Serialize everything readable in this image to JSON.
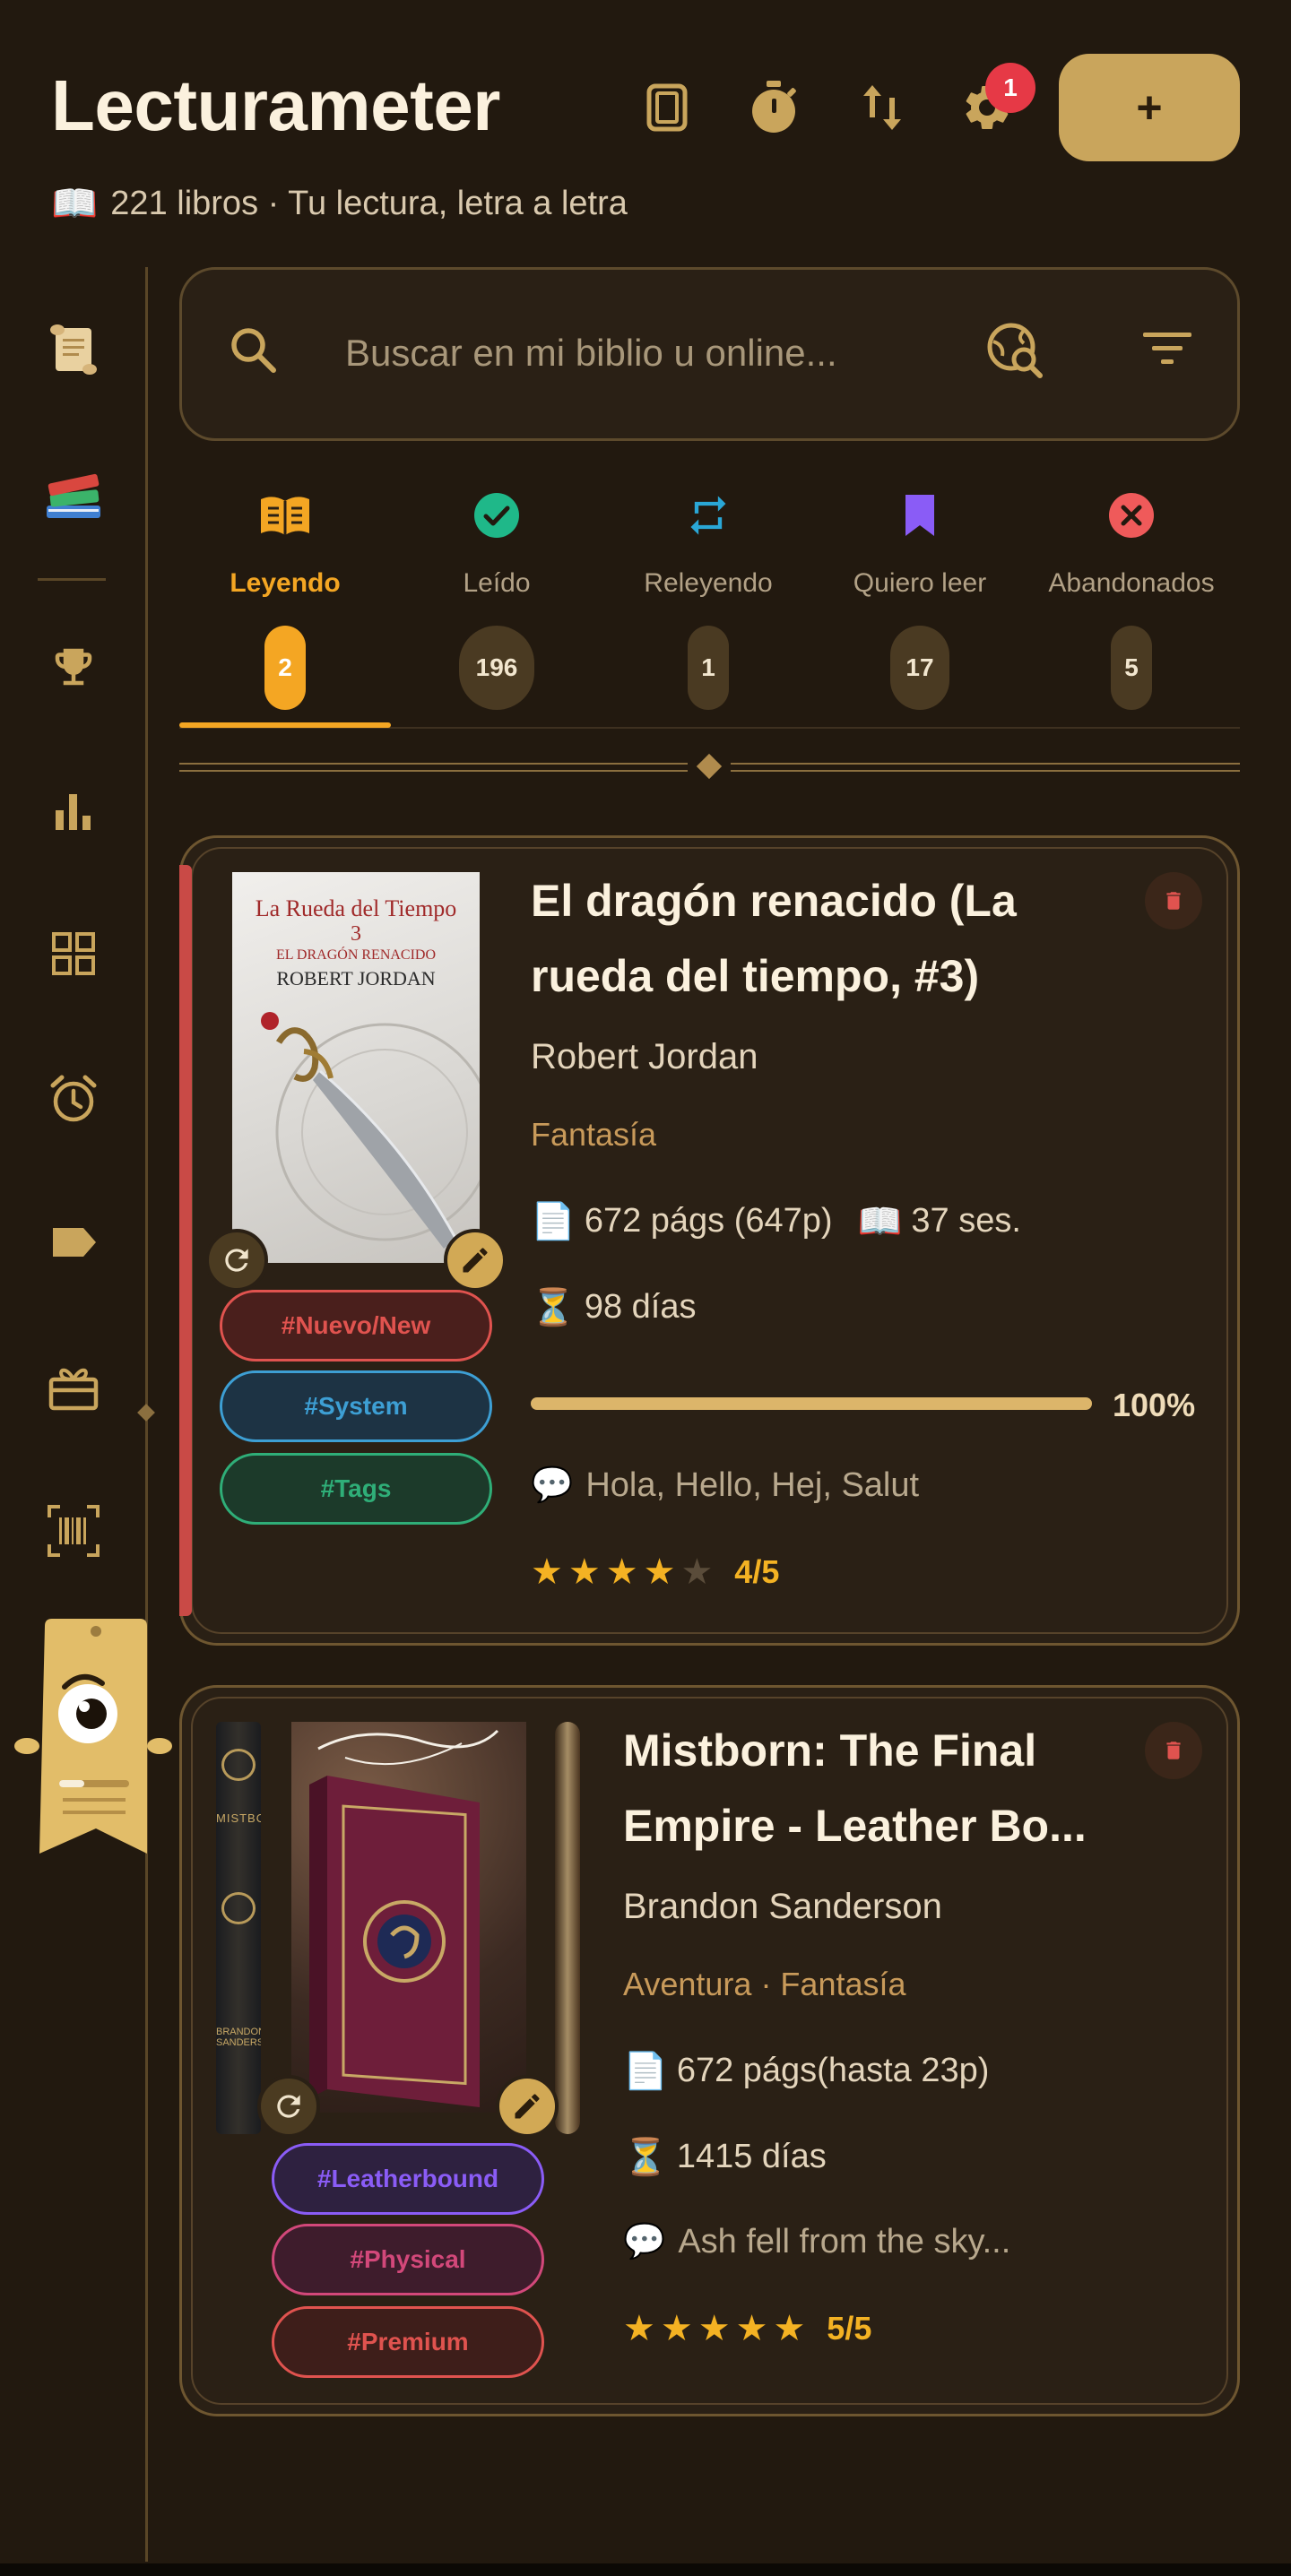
{
  "header": {
    "title": "Lecturameter",
    "subtitle_icon": "📖",
    "subtitle": "221 libros · Tu lectura, letra a letra",
    "notification_count": "1",
    "add_label": "+"
  },
  "search": {
    "placeholder": "Buscar en mi biblio u online..."
  },
  "tabs": [
    {
      "label": "Leyendo",
      "count": "2",
      "color": "#f4a623",
      "icon": "open-book-icon"
    },
    {
      "label": "Leído",
      "count": "196",
      "color": "#1fb889",
      "icon": "check-circle-icon"
    },
    {
      "label": "Releyendo",
      "count": "1",
      "color": "#2aa7d6",
      "icon": "repeat-icon"
    },
    {
      "label": "Quiero leer",
      "count": "17",
      "color": "#8a5cf6",
      "icon": "bookmark-icon"
    },
    {
      "label": "Abandonados",
      "count": "5",
      "color": "#ef5a5a",
      "icon": "cancel-circle-icon"
    }
  ],
  "sidebar": [
    "scroll-icon",
    "books-icon",
    "trophy-icon",
    "bar-chart-icon",
    "grid-icon",
    "alarm-icon",
    "label-icon",
    "gift-icon",
    "barcode-icon"
  ],
  "books": [
    {
      "title": "El dragón renacido (La rueda del tiempo, #3)",
      "author": "Robert Jordan",
      "genres": "Fantasía",
      "pages_icon": "📄",
      "pages": "672 págs (647p)",
      "sessions_icon": "📖",
      "sessions": "37 ses.",
      "days_icon": "⏳",
      "days": "98 días",
      "progress": 100,
      "progress_label": "100%",
      "note_icon": "💬",
      "note": "Hola, Hello, Hej, Salut",
      "rating": 4,
      "rating_label": "4/5",
      "cover": {
        "series_line": "La Rueda del Tiempo",
        "number": "3",
        "subtitle": "EL DRAGÓN RENACIDO",
        "author": "ROBERT JORDAN"
      },
      "tags": [
        {
          "label": "#Nuevo/New",
          "color": "#e0534f",
          "bg": "#4a1f1c"
        },
        {
          "label": "#System",
          "color": "#3d9fd4",
          "bg": "#1d3344"
        },
        {
          "label": "#Tags",
          "color": "#2fae78",
          "bg": "#1c3a2a"
        }
      ]
    },
    {
      "title": "Mistborn: The Final Empire - Leather Bo...",
      "author": "Brandon Sanderson",
      "genres": "Aventura · Fantasía",
      "pages_icon": "📄",
      "pages": "672 págs(hasta 23p)",
      "days_icon": "⏳",
      "days": "1415 días",
      "note_icon": "💬",
      "note": "Ash fell from the sky...",
      "rating": 5,
      "rating_label": "5/5",
      "cover": {
        "spine_text": "MISTBORN",
        "spine_author": "BRANDON SANDERSON"
      },
      "tags": [
        {
          "label": "#Leatherbound",
          "color": "#8a5cf6",
          "bg": "#2e2140"
        },
        {
          "label": "#Physical",
          "color": "#d2487a",
          "bg": "#3e1c2c"
        },
        {
          "label": "#Premium",
          "color": "#e0534f",
          "bg": "#3e1e1a"
        }
      ]
    }
  ]
}
